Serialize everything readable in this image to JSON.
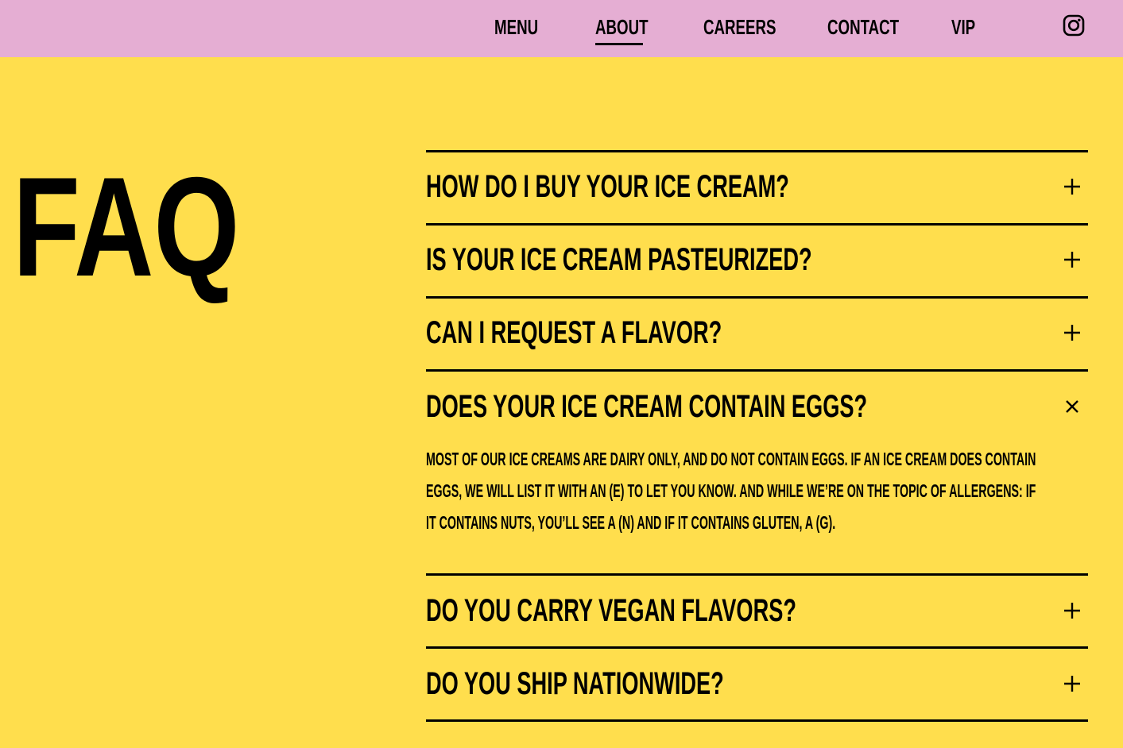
{
  "nav": {
    "items": [
      {
        "label": "MENU",
        "active": false
      },
      {
        "label": "ABOUT",
        "active": true
      },
      {
        "label": "CAREERS",
        "active": false
      },
      {
        "label": "CONTACT",
        "active": false
      },
      {
        "label": "VIP",
        "active": false
      }
    ],
    "social_icon": "instagram-icon"
  },
  "colors": {
    "header_bg": "#E5AED3",
    "page_bg": "#FFDE4D",
    "text": "#000000"
  },
  "page_title": "FAQ",
  "faq": {
    "items": [
      {
        "question": "HOW DO I BUY YOUR ICE CREAM?",
        "expanded": false,
        "icon": "plus-icon"
      },
      {
        "question": "IS YOUR ICE CREAM PASTEURIZED?",
        "expanded": false,
        "icon": "plus-icon"
      },
      {
        "question": "CAN I REQUEST A FLAVOR?",
        "expanded": false,
        "icon": "plus-icon"
      },
      {
        "question": "DOES YOUR ICE CREAM CONTAIN EGGS?",
        "expanded": true,
        "icon": "close-icon",
        "answer_lines": [
          "MOST OF OUR ICE CREAMS ARE DAIRY ONLY, AND DO NOT CONTAIN EGGS. IF AN ICE CREAM DOES CONTAIN",
          "EGGS, WE WILL LIST IT WITH AN (E) TO LET YOU KNOW. AND WHILE WE’RE ON THE TOPIC OF ALLERGENS: IF",
          "IT CONTAINS NUTS, YOU’LL SEE A (N) AND IF IT CONTAINS GLUTEN, A (G)."
        ]
      },
      {
        "question": "DO YOU CARRY VEGAN FLAVORS?",
        "expanded": false,
        "icon": "plus-icon"
      },
      {
        "question": "DO YOU SHIP NATIONWIDE?",
        "expanded": false,
        "icon": "plus-icon"
      }
    ]
  }
}
